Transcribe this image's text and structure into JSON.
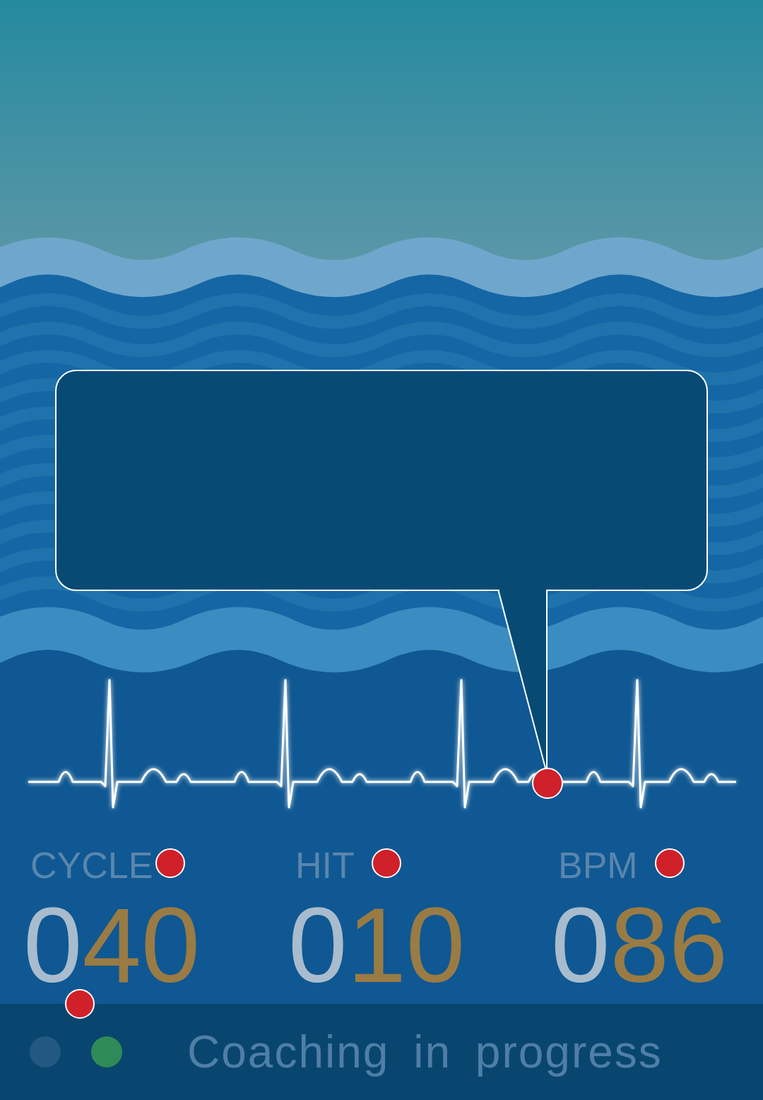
{
  "bubble": {
    "text": ""
  },
  "ecg": {
    "beats": 4,
    "marker": true
  },
  "stats": [
    {
      "label": "CYCLE",
      "dim": "0",
      "bright": "40",
      "marker": true
    },
    {
      "label": "HIT",
      "dim": "0",
      "bright": "10",
      "marker": true
    },
    {
      "label": "BPM",
      "dim": "0",
      "bright": "86",
      "marker": true
    }
  ],
  "status": {
    "text": "Coaching in progress",
    "marker": true,
    "indicators": [
      {
        "selected": false,
        "color": "#2a5d87"
      },
      {
        "selected": true,
        "color": "#2e8b57"
      }
    ]
  }
}
